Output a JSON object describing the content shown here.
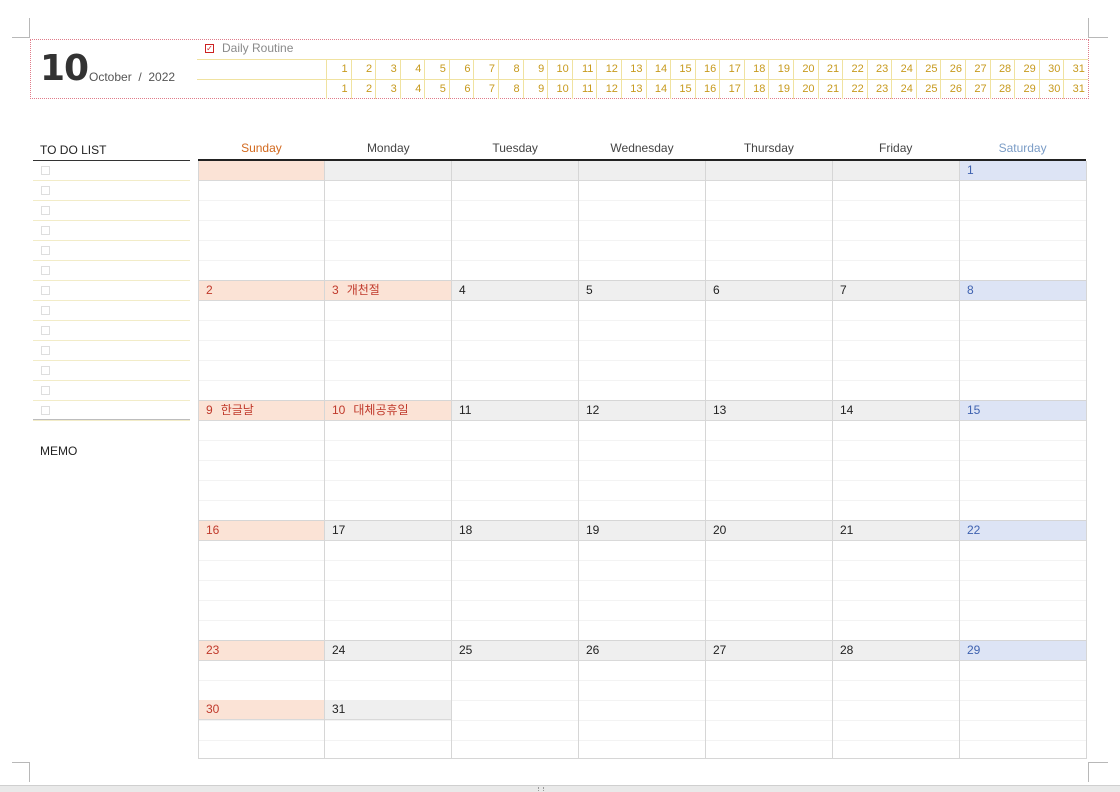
{
  "header": {
    "month_number": "10",
    "month_name": "October",
    "separator": "/",
    "year": "2022",
    "routine_title": "Daily  Routine",
    "routine_checkbox": "☑",
    "routine_days": [
      "1",
      "2",
      "3",
      "4",
      "5",
      "6",
      "7",
      "8",
      "9",
      "10",
      "11",
      "12",
      "13",
      "14",
      "15",
      "16",
      "17",
      "18",
      "19",
      "20",
      "21",
      "22",
      "23",
      "24",
      "25",
      "26",
      "27",
      "28",
      "29",
      "30",
      "31"
    ]
  },
  "todo": {
    "title": "TO  DO  LIST",
    "item_count": 13
  },
  "memo": {
    "title": "MEMO"
  },
  "calendar": {
    "weekdays": [
      "Sunday",
      "Monday",
      "Tuesday",
      "Wednesday",
      "Thursday",
      "Friday",
      "Saturday"
    ],
    "weeks": [
      [
        {
          "day": ""
        },
        {
          "day": ""
        },
        {
          "day": ""
        },
        {
          "day": ""
        },
        {
          "day": ""
        },
        {
          "day": ""
        },
        {
          "day": "1"
        }
      ],
      [
        {
          "day": "2"
        },
        {
          "day": "3",
          "holiday": "개천절"
        },
        {
          "day": "4"
        },
        {
          "day": "5"
        },
        {
          "day": "6"
        },
        {
          "day": "7"
        },
        {
          "day": "8"
        }
      ],
      [
        {
          "day": "9",
          "holiday": "한글날"
        },
        {
          "day": "10",
          "holiday": "대체공휴일"
        },
        {
          "day": "11"
        },
        {
          "day": "12"
        },
        {
          "day": "13"
        },
        {
          "day": "14"
        },
        {
          "day": "15"
        }
      ],
      [
        {
          "day": "16"
        },
        {
          "day": "17"
        },
        {
          "day": "18"
        },
        {
          "day": "19"
        },
        {
          "day": "20"
        },
        {
          "day": "21"
        },
        {
          "day": "22"
        }
      ],
      [
        {
          "day": "23"
        },
        {
          "day": "24"
        },
        {
          "day": "25"
        },
        {
          "day": "26"
        },
        {
          "day": "27"
        },
        {
          "day": "28"
        },
        {
          "day": "29"
        }
      ]
    ],
    "overflow": [
      {
        "day": "30"
      },
      {
        "day": "31"
      }
    ]
  },
  "colors": {
    "sunday_bg": "#fbe3d6",
    "sunday_text": "#c0392b",
    "saturday_bg": "#dde4f5",
    "saturday_text": "#3f62b0",
    "weekday_bg": "#efefef",
    "routine_grid": "#f0e2a0",
    "routine_numbers": "#c79a1e",
    "header_border": "#e07b8a"
  }
}
